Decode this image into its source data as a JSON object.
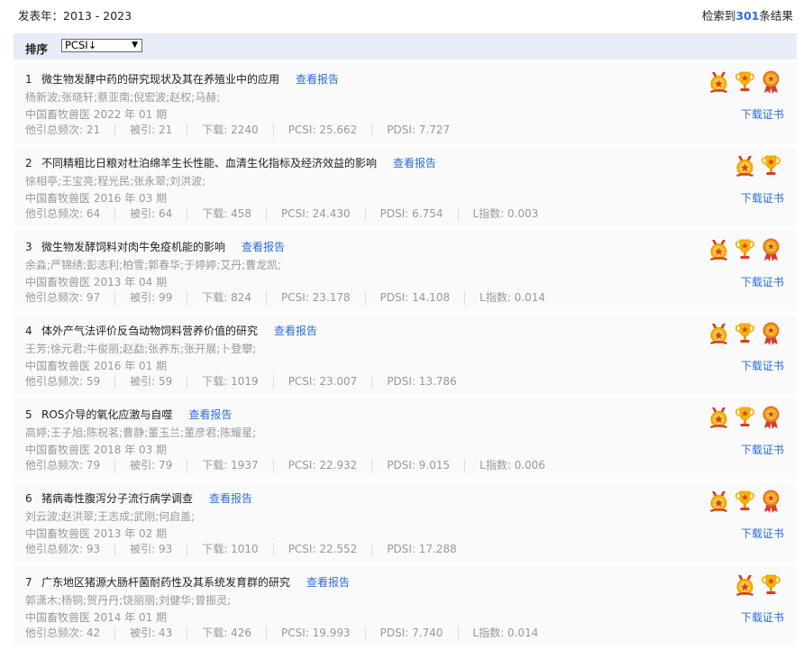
{
  "header": {
    "year_label": "发表年：2013 - 2023",
    "count_prefix": "检索到",
    "count_value": "301",
    "count_suffix": "条结果"
  },
  "sort": {
    "label": "排序",
    "selected": "PCSI↓"
  },
  "colors": {
    "link": "#2b6fd6",
    "muted": "#999999",
    "sort_bg": "#e6edf8"
  },
  "results": [
    {
      "num": "1",
      "title": "微生物发酵中药的研究现状及其在养殖业中的应用",
      "report": "查看报告",
      "authors": "杨新波;张晓轩;蔡亚南;倪宏波;赵权;马赫;",
      "source": "中国畜牧兽医 2022 年 01 期",
      "total_cited": "他引总频次: 21",
      "cited": "被引: 21",
      "downloads": "下载: 2240",
      "pcsi": "PCSI: 25.662",
      "pdsi": "PDSI: 7.727",
      "l_index": "",
      "badges": [
        "medal-icon",
        "trophy-icon",
        "rosette-icon"
      ],
      "cert": "下载证书"
    },
    {
      "num": "2",
      "title": "不同精粗比日粮对杜泊绵羊生长性能、血清生化指标及经济效益的影响",
      "report": "查看报告",
      "authors": "徐相亭;王宝亮;程光民;张永翠;刘洪波;",
      "source": "中国畜牧兽医 2016 年 03 期",
      "total_cited": "他引总频次: 64",
      "cited": "被引: 64",
      "downloads": "下载: 458",
      "pcsi": "PCSI: 24.430",
      "pdsi": "PDSI: 6.754",
      "l_index": "L指数: 0.003",
      "badges": [
        "medal-icon",
        "trophy-icon"
      ],
      "cert": "下载证书"
    },
    {
      "num": "3",
      "title": "微生物发酵饲料对肉牛免疫机能的影响",
      "report": "查看报告",
      "authors": "余淼;严锦绣;彭志利;柏雪;郭春华;于婷婷;艾丹;曹龙凯;",
      "source": "中国畜牧兽医 2013 年 04 期",
      "total_cited": "他引总频次: 97",
      "cited": "被引: 99",
      "downloads": "下载: 824",
      "pcsi": "PCSI: 23.178",
      "pdsi": "PDSI: 14.108",
      "l_index": "L指数: 0.014",
      "badges": [
        "medal-icon",
        "trophy-icon",
        "rosette-icon"
      ],
      "cert": "下载证书"
    },
    {
      "num": "4",
      "title": "体外产气法评价反刍动物饲料营养价值的研究",
      "report": "查看报告",
      "authors": "王芳;徐元君;牛俊丽;赵勐;张养东;张开展;卜登攀;",
      "source": "中国畜牧兽医 2016 年 01 期",
      "total_cited": "他引总频次: 59",
      "cited": "被引: 59",
      "downloads": "下载: 1019",
      "pcsi": "PCSI: 23.007",
      "pdsi": "PDSI: 13.786",
      "l_index": "",
      "badges": [
        "medal-icon",
        "trophy-icon",
        "rosette-icon"
      ],
      "cert": "下载证书"
    },
    {
      "num": "5",
      "title": "ROS介导的氧化应激与自噬",
      "report": "查看报告",
      "authors": "高婷;王子旭;陈祝茗;曹静;董玉兰;董彦君;陈耀星;",
      "source": "中国畜牧兽医 2018 年 03 期",
      "total_cited": "他引总频次: 79",
      "cited": "被引: 79",
      "downloads": "下载: 1937",
      "pcsi": "PCSI: 22.932",
      "pdsi": "PDSI: 9.015",
      "l_index": "L指数: 0.006",
      "badges": [
        "medal-icon",
        "trophy-icon",
        "rosette-icon"
      ],
      "cert": "下载证书"
    },
    {
      "num": "6",
      "title": "猪病毒性腹泻分子流行病学调查",
      "report": "查看报告",
      "authors": "刘云波;赵洪翠;王志成;武刚;何启盖;",
      "source": "中国畜牧兽医 2013 年 02 期",
      "total_cited": "他引总频次: 93",
      "cited": "被引: 93",
      "downloads": "下载: 1010",
      "pcsi": "PCSI: 22.552",
      "pdsi": "PDSI: 17.288",
      "l_index": "",
      "badges": [
        "medal-icon",
        "trophy-icon",
        "rosette-icon"
      ],
      "cert": "下载证书"
    },
    {
      "num": "7",
      "title": "广东地区猪源大肠杆菌耐药性及其系统发育群的研究",
      "report": "查看报告",
      "authors": "郭潇木;杨铜;贺丹丹;饶丽丽;刘健华;曾振灵;",
      "source": "中国畜牧兽医 2014 年 01 期",
      "total_cited": "他引总频次: 42",
      "cited": "被引: 43",
      "downloads": "下载: 426",
      "pcsi": "PCSI: 19.993",
      "pdsi": "PDSI: 7.740",
      "l_index": "L指数: 0.014",
      "badges": [
        "medal-icon",
        "trophy-icon"
      ],
      "cert": "下载证书"
    }
  ]
}
